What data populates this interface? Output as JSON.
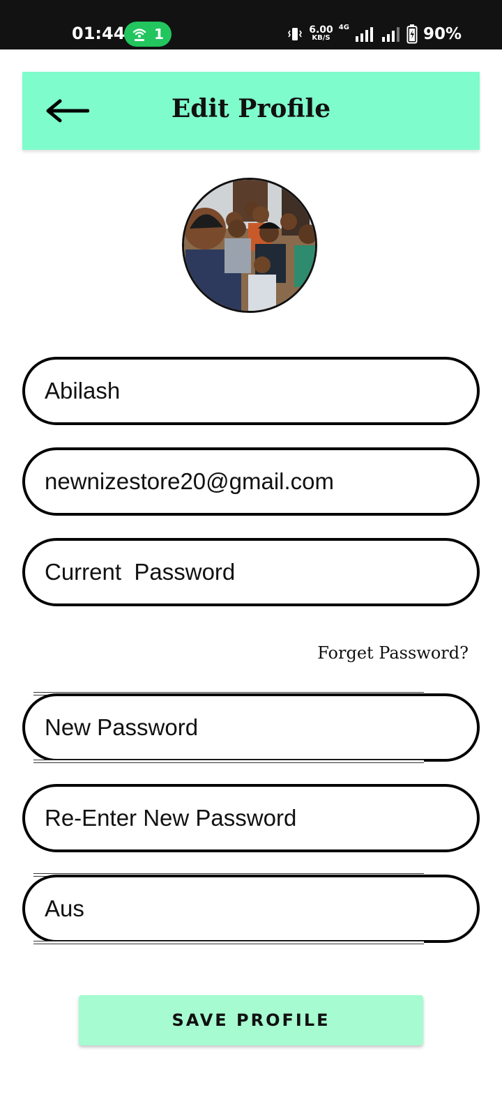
{
  "status_bar": {
    "time": "01:44",
    "hotspot_count": "1",
    "speed_value": "6.00",
    "speed_unit": "KB/S",
    "network_type": "4G",
    "battery": "90%"
  },
  "header": {
    "title": "Edit Profile",
    "back_icon": "back-arrow-icon",
    "background": "#7ffccc"
  },
  "form": {
    "name": "Abilash",
    "email": "newnizestore20@gmail.com",
    "current_password_placeholder": "Current  Password",
    "forget_password": "Forget Password?",
    "new_password_placeholder": "New Password",
    "reenter_password_placeholder": "Re-Enter New Password",
    "country": "Aus"
  },
  "save_button": {
    "label": "SAVE PROFILE",
    "background": "#a6fcd0"
  }
}
